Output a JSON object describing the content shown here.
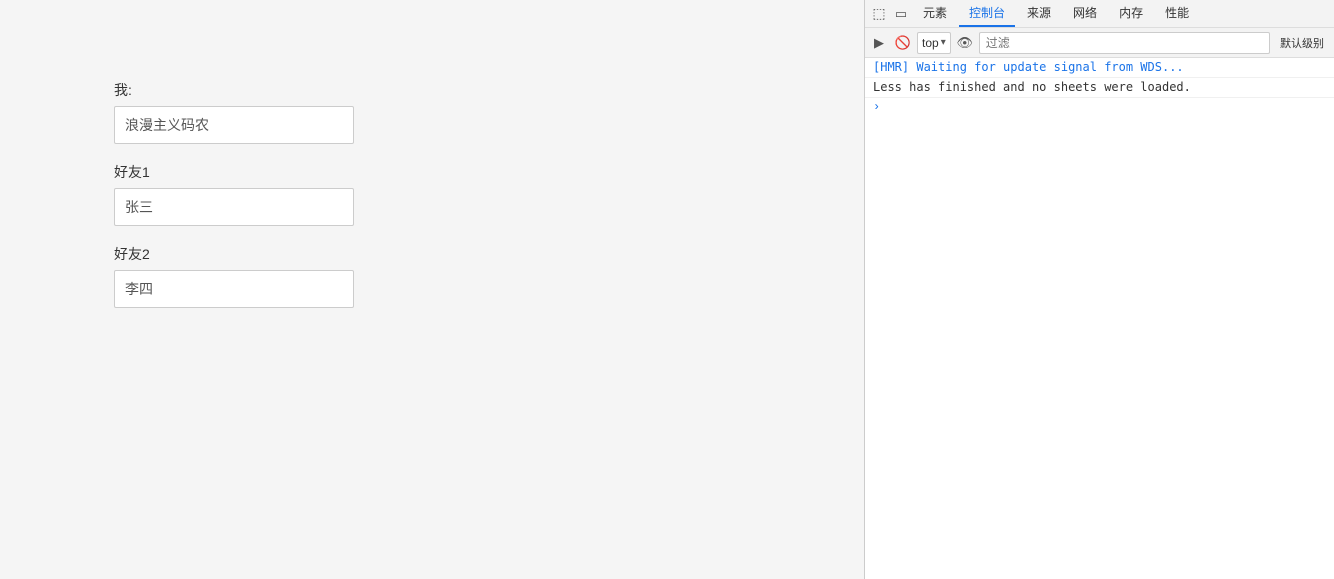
{
  "main": {
    "fields": [
      {
        "label": "我:",
        "value": "浪漫主义码农"
      },
      {
        "label": "好友1",
        "value": "张三"
      },
      {
        "label": "好友2",
        "value": "李四"
      }
    ]
  },
  "devtools": {
    "tabs": [
      {
        "label": "元素",
        "active": false
      },
      {
        "label": "控制台",
        "active": true
      },
      {
        "label": "来源",
        "active": false
      },
      {
        "label": "网络",
        "active": false
      },
      {
        "label": "内存",
        "active": false
      },
      {
        "label": "性能",
        "active": false
      }
    ],
    "toolbar": {
      "context_label": "top",
      "filter_placeholder": "过滤",
      "log_level_label": "默认级别"
    },
    "console_lines": [
      {
        "type": "hmr",
        "text": "[HMR] Waiting for update signal from WDS..."
      },
      {
        "type": "less",
        "text": "Less has finished and no sheets were loaded."
      }
    ],
    "prompt_chevron": "›"
  }
}
